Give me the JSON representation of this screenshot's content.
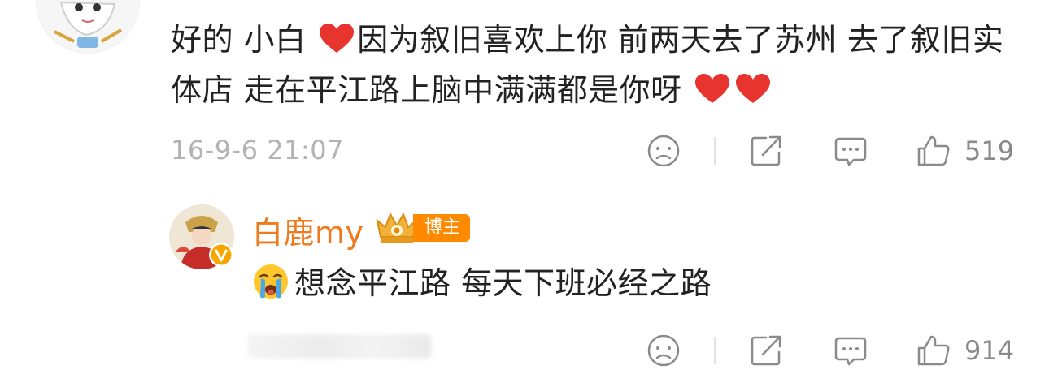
{
  "comment": {
    "text_part1": "好的 小白",
    "text_part2": "因为叙旧喜欢上你 前两天去了苏州 去了叙旧实体店 走在平江路上脑中满满都是你呀",
    "timestamp": "16-9-6 21:07",
    "like_count": "519",
    "heart_color": "#e8342f"
  },
  "reply": {
    "author_name": "白鹿my",
    "author_tag": "博主",
    "text": "想念平江路 每天下班必经之路",
    "like_count": "914",
    "name_color": "#ef7b20",
    "tag_color": "#ff8a00"
  },
  "icons": {
    "dislike": "sad-face-icon",
    "share": "share-icon",
    "comment": "comment-bubble-icon",
    "like": "thumbs-up-icon",
    "heart": "heart-emoji-icon",
    "cry": "crying-emoji-icon",
    "verified": "verified-v-icon"
  }
}
